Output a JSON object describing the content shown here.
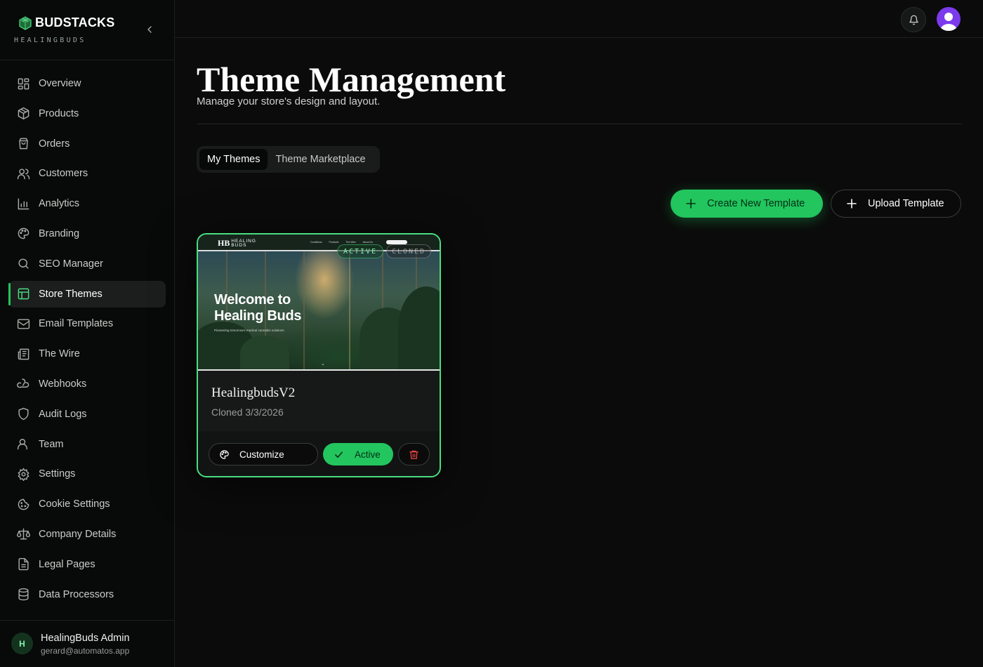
{
  "brand": {
    "name": "BUDSTACKS",
    "subtitle": "HEALINGBUDS"
  },
  "sidebar": {
    "items": [
      {
        "label": "Overview",
        "icon": "layout-dashboard-icon"
      },
      {
        "label": "Products",
        "icon": "package-icon"
      },
      {
        "label": "Orders",
        "icon": "shopping-bag-icon"
      },
      {
        "label": "Customers",
        "icon": "users-icon"
      },
      {
        "label": "Analytics",
        "icon": "bar-chart-icon"
      },
      {
        "label": "Branding",
        "icon": "palette-icon"
      },
      {
        "label": "SEO Manager",
        "icon": "search-icon"
      },
      {
        "label": "Store Themes",
        "icon": "layout-template-icon",
        "active": true
      },
      {
        "label": "Email Templates",
        "icon": "mail-icon"
      },
      {
        "label": "The Wire",
        "icon": "newspaper-icon"
      },
      {
        "label": "Webhooks",
        "icon": "webhook-icon"
      },
      {
        "label": "Audit Logs",
        "icon": "shield-icon"
      },
      {
        "label": "Team",
        "icon": "user-icon"
      },
      {
        "label": "Settings",
        "icon": "gear-icon"
      },
      {
        "label": "Cookie Settings",
        "icon": "cookie-icon"
      },
      {
        "label": "Company Details",
        "icon": "scale-icon"
      },
      {
        "label": "Legal Pages",
        "icon": "file-text-icon"
      },
      {
        "label": "Data Processors",
        "icon": "database-icon"
      }
    ]
  },
  "user": {
    "initial": "H",
    "name": "HealingBuds Admin",
    "email": "gerard@automatos.app"
  },
  "page": {
    "title": "Theme Management",
    "subtitle": "Manage your store's design and layout."
  },
  "tabs": [
    "My Themes",
    "Theme Marketplace"
  ],
  "actions": {
    "create": "Create New Template",
    "upload": "Upload Template"
  },
  "theme_card": {
    "name": "HealingbudsV2",
    "date": "Cloned 3/3/2026",
    "badge_active": "ACTIVE",
    "badge_cloned": "CLONED",
    "preview": {
      "logo_mark": "HB",
      "logo_text_1": "HEALING",
      "logo_text_2": "BUDS",
      "nav_links": [
        "Conditions",
        "Products",
        "The Wire",
        "About Us"
      ],
      "headline_1": "Welcome to",
      "headline_2": "Healing Buds",
      "tagline": "Pioneering tomorrow's medical cannabis solutions"
    },
    "customize_label": "Customize",
    "active_label": "Active"
  },
  "colors": {
    "accent": "#22c55e",
    "accent_light": "#4ade80",
    "background": "#0b0b0b",
    "sidebar": "#070a08",
    "avatar": "#7c3aed",
    "danger": "#ef4444"
  }
}
